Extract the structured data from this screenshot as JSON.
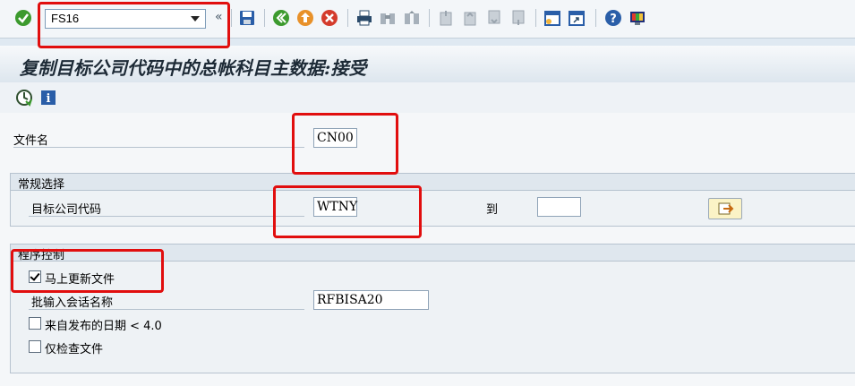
{
  "toolbar": {
    "command_field": {
      "value": "FS16"
    },
    "expand_glyph": "«",
    "icons": [
      "enter-icon",
      "save-icon",
      "back-icon",
      "exit-icon",
      "cancel-icon",
      "print-icon",
      "find-icon",
      "find-next-icon",
      "first-page-icon",
      "previous-page-icon",
      "next-page-icon",
      "last-page-icon",
      "create-session-icon",
      "shortcut-icon",
      "help-icon",
      "customize-layout-icon"
    ]
  },
  "page": {
    "title": "复制目标公司代码中的总帐科目主数据:接受"
  },
  "app_toolbar": {
    "icons": [
      "execute-icon",
      "info-icon"
    ]
  },
  "form": {
    "file_name": {
      "label": "文件名",
      "value": "CN00"
    },
    "general_selection": {
      "title": "常规选择",
      "target_company_code": {
        "label": "目标公司代码",
        "value": "WTNY"
      },
      "to_label": "到",
      "to_value": ""
    },
    "program_control": {
      "title": "程序控制",
      "update_immediately": {
        "label": "马上更新文件",
        "checked": true
      },
      "batch_session_name": {
        "label": "批输入会话名称",
        "value": "RFBISA20"
      },
      "from_release": {
        "label": "来自发布的日期 < 4.0",
        "checked": false
      },
      "check_file_only": {
        "label": "仅检查文件",
        "checked": false
      }
    }
  },
  "colors": {
    "highlight_box": "#e10e0e",
    "title_text": "#1d2a36",
    "background": "#dfe9f2"
  }
}
